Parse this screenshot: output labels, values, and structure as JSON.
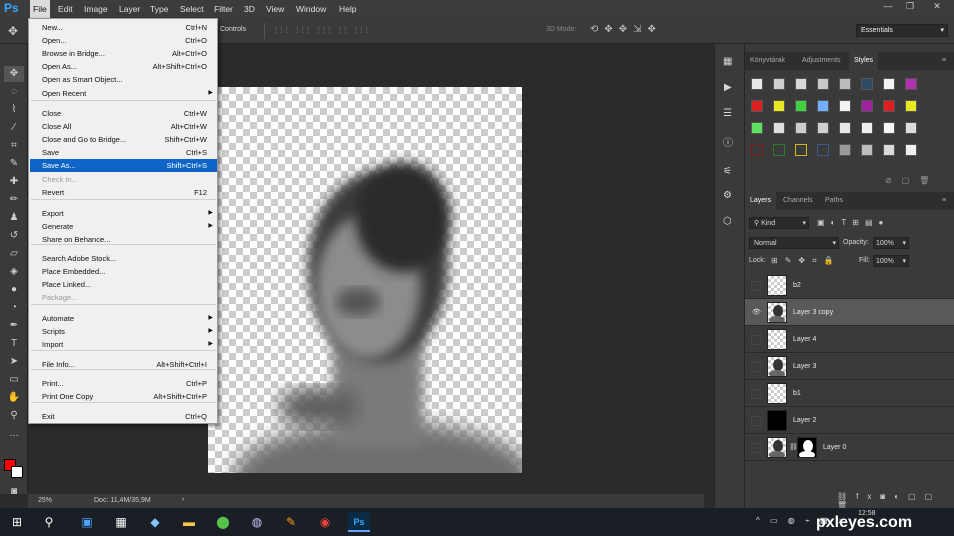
{
  "menubar": {
    "app": "Ps",
    "items": [
      "File",
      "Edit",
      "Image",
      "Layer",
      "Type",
      "Select",
      "Filter",
      "3D",
      "View",
      "Window",
      "Help"
    ]
  },
  "options": {
    "controls_label": "Controls",
    "mode_label": "3D Mode:",
    "workspace": "Essentials"
  },
  "file_menu": [
    {
      "label": "New...",
      "shortcut": "Ctrl+N"
    },
    {
      "label": "Open...",
      "shortcut": "Ctrl+O"
    },
    {
      "label": "Browse in Bridge...",
      "shortcut": "Alt+Ctrl+O"
    },
    {
      "label": "Open As...",
      "shortcut": "Alt+Shift+Ctrl+O"
    },
    {
      "label": "Open as Smart Object...",
      "shortcut": ""
    },
    {
      "label": "Open Recent",
      "shortcut": ""
    },
    {
      "label": "Close",
      "shortcut": "Ctrl+W"
    },
    {
      "label": "Close All",
      "shortcut": "Alt+Ctrl+W"
    },
    {
      "label": "Close and Go to Bridge...",
      "shortcut": "Shift+Ctrl+W"
    },
    {
      "label": "Save",
      "shortcut": "Ctrl+S"
    },
    {
      "label": "Save As...",
      "shortcut": "Shift+Ctrl+S"
    },
    {
      "label": "Check In...",
      "shortcut": ""
    },
    {
      "label": "Revert",
      "shortcut": "F12"
    },
    {
      "label": "Export",
      "shortcut": ""
    },
    {
      "label": "Generate",
      "shortcut": ""
    },
    {
      "label": "Share on Behance...",
      "shortcut": ""
    },
    {
      "label": "Search Adobe Stock...",
      "shortcut": ""
    },
    {
      "label": "Place Embedded...",
      "shortcut": ""
    },
    {
      "label": "Place Linked...",
      "shortcut": ""
    },
    {
      "label": "Package...",
      "shortcut": ""
    },
    {
      "label": "Automate",
      "shortcut": ""
    },
    {
      "label": "Scripts",
      "shortcut": ""
    },
    {
      "label": "Import",
      "shortcut": ""
    },
    {
      "label": "File Info...",
      "shortcut": "Alt+Shift+Ctrl+I"
    },
    {
      "label": "Print...",
      "shortcut": "Ctrl+P"
    },
    {
      "label": "Print One Copy",
      "shortcut": "Alt+Shift+Ctrl+P"
    },
    {
      "label": "Exit",
      "shortcut": "Ctrl+Q"
    }
  ],
  "status": {
    "zoom": "25%",
    "doc": "Doc: 11,4M/35,9M"
  },
  "styles_panel": {
    "tabs": [
      "Könyvtárak",
      "Adjustments",
      "Styles"
    ],
    "active": "Styles"
  },
  "layers_panel": {
    "tabs": [
      "Layers",
      "Channels",
      "Paths"
    ],
    "active": "Layers",
    "kind": "Kind",
    "blend": "Normal",
    "opacity_label": "Opacity:",
    "opacity": "100%",
    "lock_label": "Lock:",
    "fill_label": "Fill:",
    "fill": "100%",
    "layers": [
      {
        "name": "b2",
        "visible": false,
        "selected": false,
        "thumb": "transparent"
      },
      {
        "name": "Layer 3 copy",
        "visible": true,
        "selected": true,
        "thumb": "portrait"
      },
      {
        "name": "Layer 4",
        "visible": false,
        "selected": false,
        "thumb": "transparent"
      },
      {
        "name": "Layer 3",
        "visible": false,
        "selected": false,
        "thumb": "portrait"
      },
      {
        "name": "b1",
        "visible": false,
        "selected": false,
        "thumb": "transparent"
      },
      {
        "name": "Layer 2",
        "visible": false,
        "selected": false,
        "thumb": "black"
      },
      {
        "name": "Layer 0",
        "visible": false,
        "selected": false,
        "thumb": "portrait-mask"
      }
    ],
    "footer_icons": [
      "link-icon",
      "fx-icon",
      "mask-icon",
      "adjustment-icon",
      "folder-icon",
      "new-layer-icon",
      "trash-icon"
    ]
  },
  "taskbar": {
    "time": "12:58",
    "watermark": "pxleyes.com"
  },
  "colors": {
    "highlight": "#0e64c9",
    "foreground": "#ff0000",
    "background": "#ffffff"
  }
}
